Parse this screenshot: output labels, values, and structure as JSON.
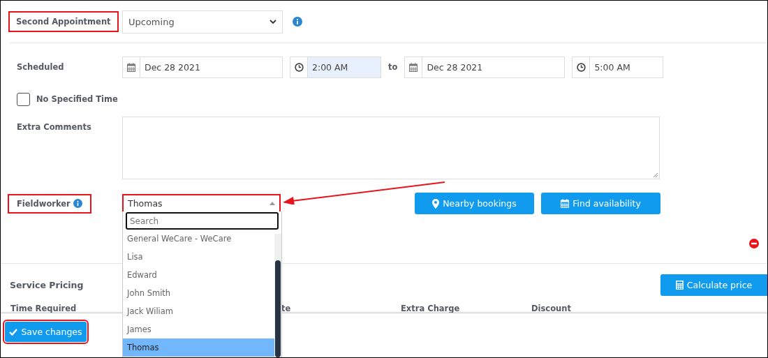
{
  "status": {
    "label": "Second Appointment",
    "highlighted": true,
    "value": "Upcoming"
  },
  "scheduled": {
    "label": "Scheduled",
    "start_date": "Dec 28 2021",
    "start_time": "2:00 AM",
    "start_time_focused": true,
    "separator": "to",
    "end_date": "Dec 28 2021",
    "end_time": "5:00 AM"
  },
  "no_specified_time": {
    "label": "No Specified Time",
    "checked": false
  },
  "extra_comments": {
    "label": "Extra Comments"
  },
  "fieldworker": {
    "label": "Fieldworker",
    "highlighted": true,
    "value": "Thomas",
    "value_highlighted": true,
    "expanded": true,
    "search_placeholder": "Search",
    "options": [
      {
        "label": "General WeCare - WeCare",
        "selected": false
      },
      {
        "label": "Lisa",
        "selected": false
      },
      {
        "label": "Edward",
        "selected": false
      },
      {
        "label": "John Smith",
        "selected": false
      },
      {
        "label": "Jack Wiliam",
        "selected": false
      },
      {
        "label": "James",
        "selected": false
      },
      {
        "label": "Thomas",
        "selected": true
      }
    ]
  },
  "fieldworker_buttons": [
    "Nearby bookings",
    "Find availability"
  ],
  "service_pricing": {
    "title": "Service Pricing",
    "button": "Calculate price",
    "columns": [
      "Time Required",
      "te",
      "Extra Charge",
      "Discount"
    ]
  },
  "footer": {
    "button": "Save changes",
    "highlighted": true
  }
}
